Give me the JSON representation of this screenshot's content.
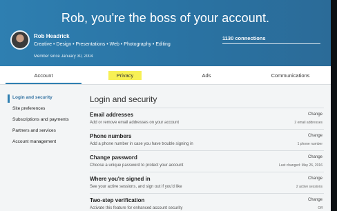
{
  "header": {
    "headline": "Rob, you're the boss of your account.",
    "profile_name": "Rob Headrick",
    "tagline": "Creative • Design • Presentations • Web • Photography • Editing",
    "member_since": "Member since January 30, 2004",
    "connections": "1130 connections"
  },
  "tabs": [
    {
      "label": "Account"
    },
    {
      "label": "Privacy"
    },
    {
      "label": "Ads"
    },
    {
      "label": "Communications"
    }
  ],
  "sidebar": {
    "items": [
      {
        "label": "Login and security",
        "active": true
      },
      {
        "label": "Site preferences"
      },
      {
        "label": "Subscriptions and payments"
      },
      {
        "label": "Partners and services"
      },
      {
        "label": "Account management"
      }
    ]
  },
  "content": {
    "title": "Login and security",
    "rows": [
      {
        "title": "Email addresses",
        "desc": "Add or remove email addresses on your account",
        "action": "Change",
        "meta": "2 email addresses"
      },
      {
        "title": "Phone numbers",
        "desc": "Add a phone number in case you have trouble signing in",
        "action": "Change",
        "meta": "1 phone number"
      },
      {
        "title": "Change password",
        "desc": "Choose a unique password to protect your account",
        "action": "Change",
        "meta": "Last changed: May 26, 2016"
      },
      {
        "title": "Where you're signed in",
        "desc": "See your active sessions, and sign out if you'd like",
        "action": "Change",
        "meta": "2 active sessions"
      },
      {
        "title": "Two-step verification",
        "desc": "Activate this feature for enhanced account security",
        "action": "Change",
        "meta": "Off"
      }
    ]
  },
  "colors": {
    "header_blue": "#2e7fb1",
    "highlight_yellow": "#f7f055",
    "link_blue": "#2e6fa0"
  }
}
